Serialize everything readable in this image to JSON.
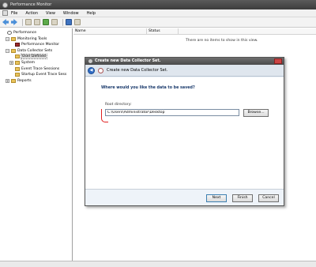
{
  "window": {
    "title": "Performance Monitor"
  },
  "menu": [
    "File",
    "Action",
    "View",
    "Window",
    "Help"
  ],
  "tree": [
    {
      "label": "Performance",
      "indent": 0,
      "icon": "perf",
      "expander": ""
    },
    {
      "label": "Monitoring Tools",
      "indent": 1,
      "icon": "folder",
      "expander": "−"
    },
    {
      "label": "Performance Monitor",
      "indent": 2,
      "icon": "chart",
      "expander": ""
    },
    {
      "label": "Data Collector Sets",
      "indent": 1,
      "icon": "folder",
      "expander": "−"
    },
    {
      "label": "User Defined",
      "indent": 2,
      "icon": "folder",
      "expander": "",
      "selected": true
    },
    {
      "label": "System",
      "indent": 2,
      "icon": "folder",
      "expander": "+"
    },
    {
      "label": "Event Trace Sessions",
      "indent": 2,
      "icon": "folder",
      "expander": ""
    },
    {
      "label": "Startup Event Trace Sess",
      "indent": 2,
      "icon": "folder",
      "expander": ""
    },
    {
      "label": "Reports",
      "indent": 1,
      "icon": "folder",
      "expander": "+"
    }
  ],
  "list": {
    "columns": [
      "Name",
      "Status"
    ],
    "empty_message": "There are no items to show in this view."
  },
  "dialog": {
    "title": "Create new Data Collector Set.",
    "header": "Create new Data Collector Set.",
    "question": "Where would you like the data to be saved?",
    "root_label": "Root directory:",
    "root_value": "C:\\Users\\Administrator\\Desktop",
    "browse": "Browse...",
    "buttons": {
      "next": "Next",
      "finish": "Finish",
      "cancel": "Cancel"
    }
  }
}
